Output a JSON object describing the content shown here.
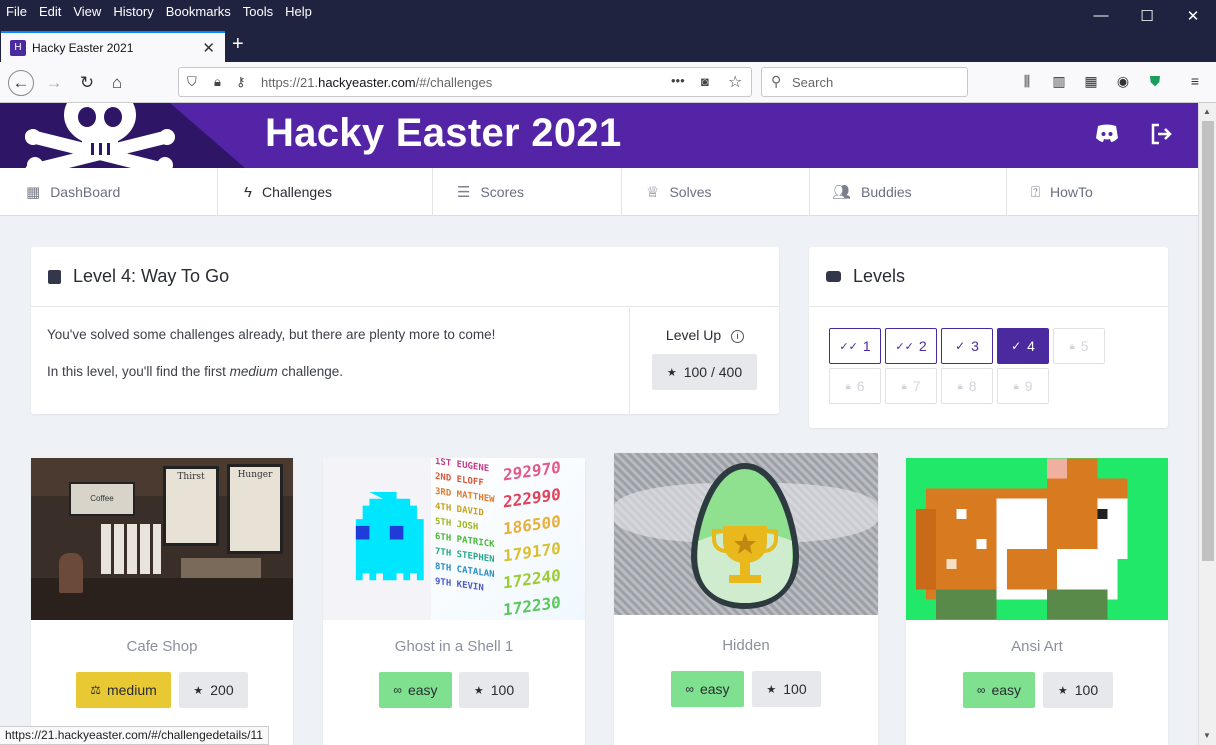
{
  "menubar": {
    "items": [
      "File",
      "Edit",
      "View",
      "History",
      "Bookmarks",
      "Tools",
      "Help"
    ]
  },
  "window_controls": {
    "minimize": "—",
    "maximize": "☐",
    "close": "✕"
  },
  "tab": {
    "title": "Hacky Easter 2021",
    "favicon": "H"
  },
  "urlbar": {
    "url_prefix": "https://21.",
    "url_domain": "hackyeaster.com",
    "url_suffix": "/#/challenges",
    "more": "•••"
  },
  "search": {
    "placeholder": "Search"
  },
  "banner": {
    "title": "Hacky Easter 2021"
  },
  "nav": [
    {
      "label": "DashBoard",
      "icon": "dashboard-icon"
    },
    {
      "label": "Challenges",
      "icon": "bolt-icon",
      "active": true
    },
    {
      "label": "Scores",
      "icon": "list-icon"
    },
    {
      "label": "Solves",
      "icon": "trophy-icon"
    },
    {
      "label": "Buddies",
      "icon": "users-icon"
    },
    {
      "label": "HowTo",
      "icon": "help-icon"
    }
  ],
  "level_card": {
    "title": "Level 4: Way To Go",
    "line1": "You've solved some challenges already, but there are plenty more to come!",
    "line2_pre": "In this level, you'll find the first ",
    "line2_em": "medium",
    "line2_post": " challenge.",
    "levelup_label": "Level Up",
    "progress": "100 / 400"
  },
  "levels_card": {
    "title": "Levels",
    "levels": [
      {
        "n": "1",
        "state": "done"
      },
      {
        "n": "2",
        "state": "done"
      },
      {
        "n": "3",
        "state": "done"
      },
      {
        "n": "4",
        "state": "current"
      },
      {
        "n": "5",
        "state": "locked"
      },
      {
        "n": "6",
        "state": "locked"
      },
      {
        "n": "7",
        "state": "locked"
      },
      {
        "n": "8",
        "state": "locked"
      },
      {
        "n": "9",
        "state": "locked"
      }
    ]
  },
  "challenges": [
    {
      "name": "Cafe Shop",
      "difficulty": "medium",
      "points": "200"
    },
    {
      "name": "Ghost in a Shell 1",
      "difficulty": "easy",
      "points": "100"
    },
    {
      "name": "Hidden",
      "difficulty": "easy",
      "points": "100"
    },
    {
      "name": "Ansi Art",
      "difficulty": "easy",
      "points": "100"
    }
  ],
  "scoreboard_text": {
    "names": [
      "1ST EUGENE",
      "2ND ELOFF",
      "3RD MATTHEW",
      "4TH DAVID",
      "5TH JOSH",
      "6TH PATRICK",
      "7TH STEPHEN",
      "8TH CATALAN",
      "9TH KEVIN"
    ],
    "scores": [
      "292970",
      "222990",
      "186500",
      "179170",
      "172240",
      "172230"
    ]
  },
  "cafe_text": {
    "board1": "Thirst",
    "board2": "Hunger",
    "mug": "Coffee"
  },
  "status_url": "https://21.hackyeaster.com/#/challengedetails/11",
  "colors": {
    "brand": "#5424a6",
    "medium": "#e8c833",
    "easy": "#7fe08f"
  }
}
